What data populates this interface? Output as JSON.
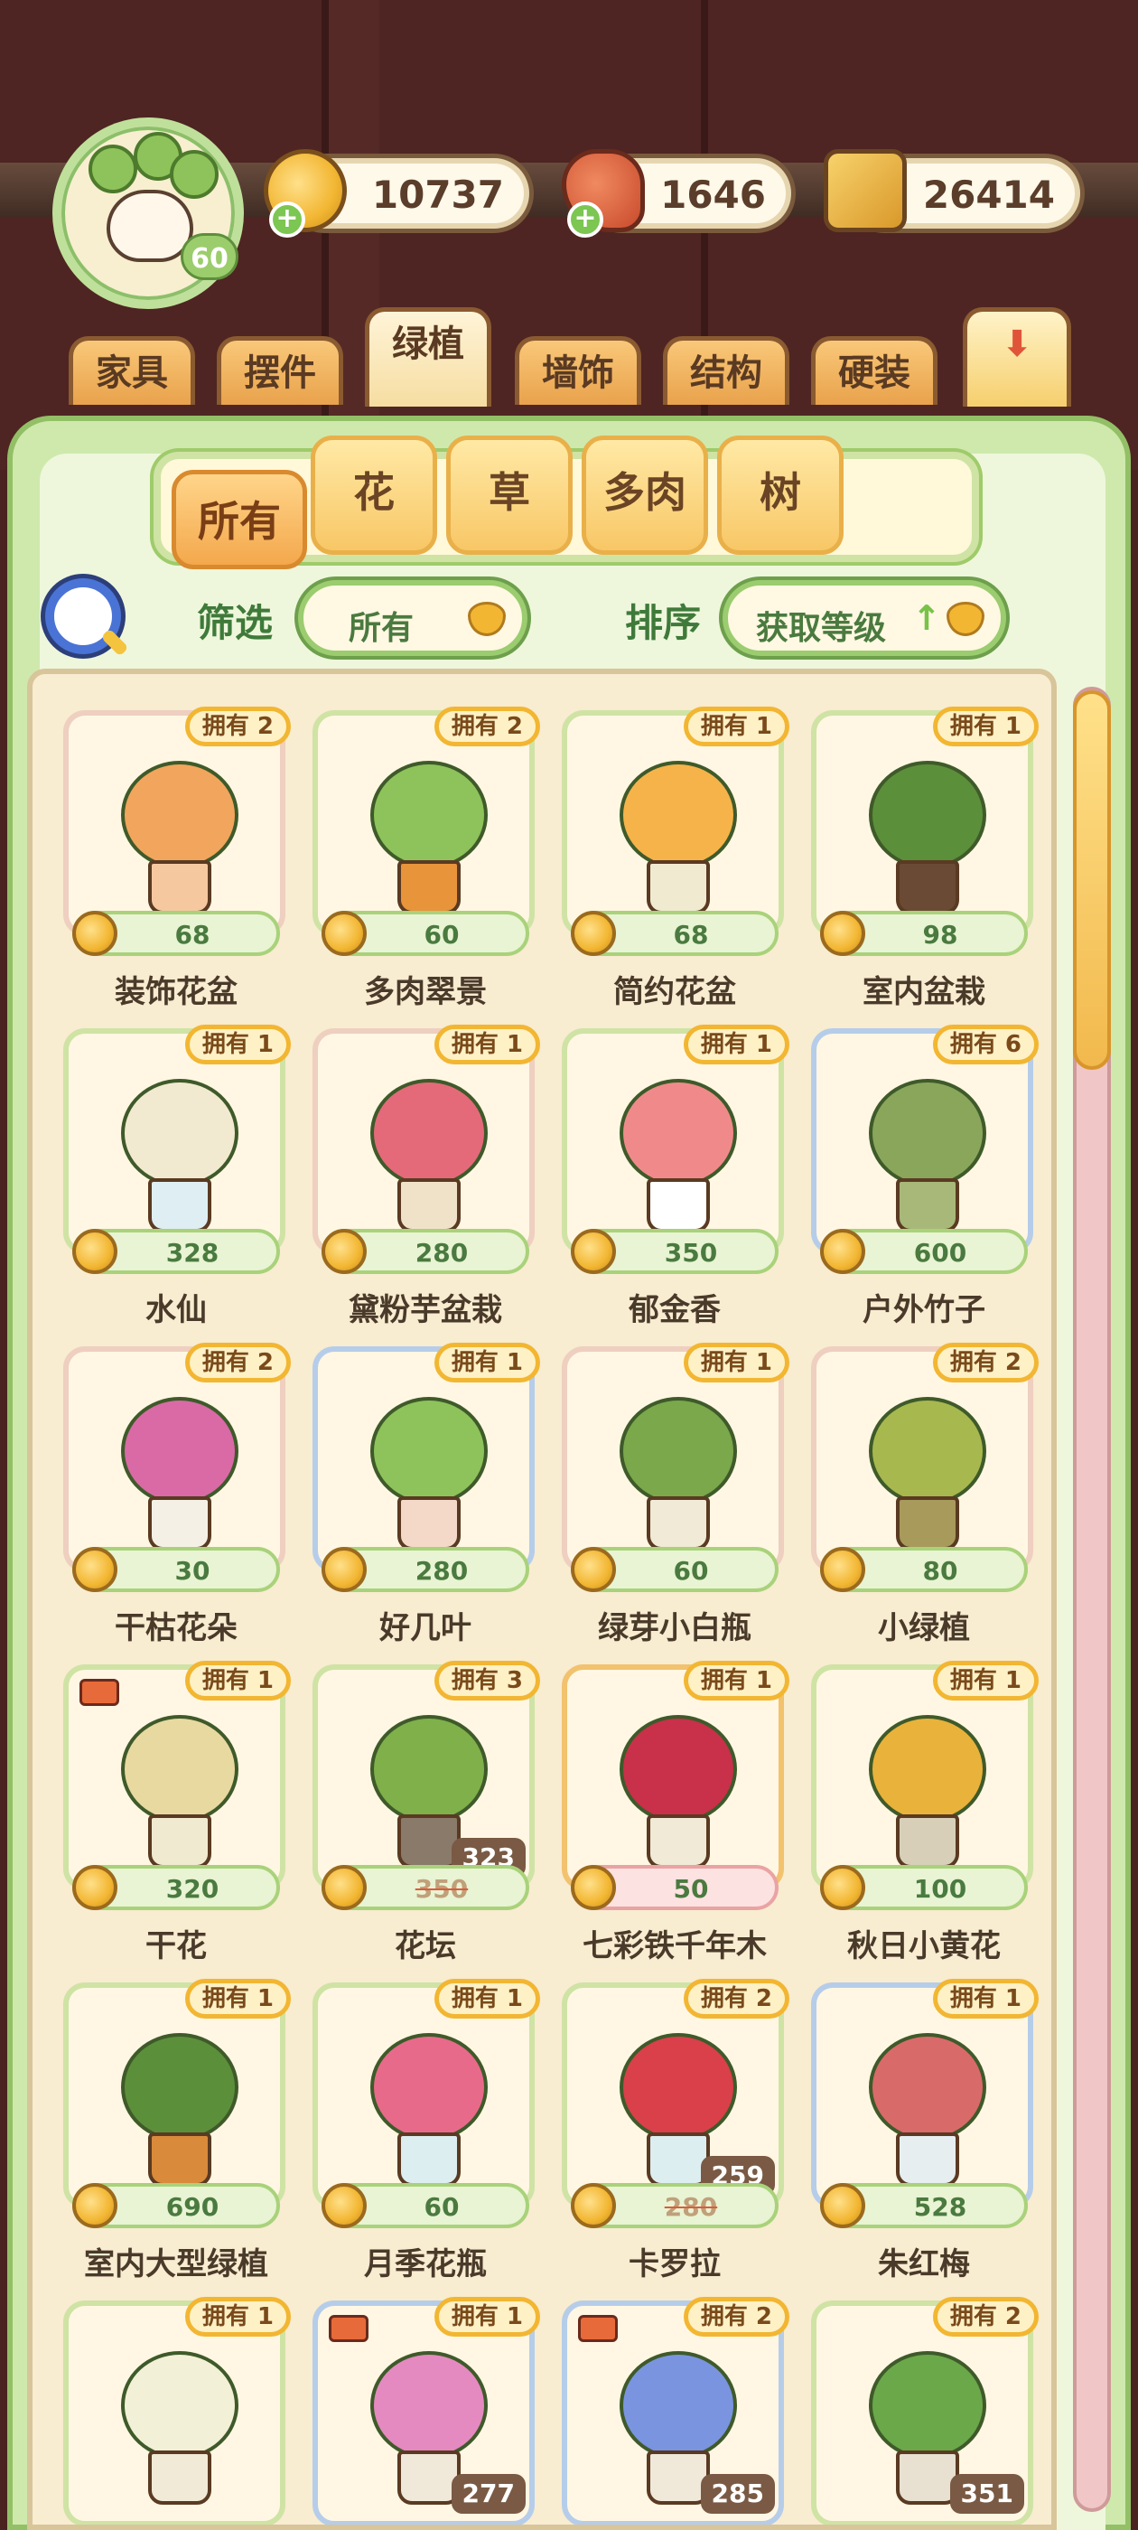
{
  "player": {
    "level": "60"
  },
  "resources": [
    {
      "name": "coin-icon",
      "value": "10737"
    },
    {
      "name": "meat-icon",
      "value": "1646"
    },
    {
      "name": "book-icon",
      "value": "26414"
    }
  ],
  "tabs": [
    {
      "label": "家具",
      "active": false
    },
    {
      "label": "摆件",
      "active": false
    },
    {
      "label": "绿植",
      "active": true
    },
    {
      "label": "墙饰",
      "active": false
    },
    {
      "label": "结构",
      "active": false
    },
    {
      "label": "硬装",
      "active": false
    }
  ],
  "subtabs": [
    {
      "label": "所有",
      "active": true
    },
    {
      "label": "花",
      "active": false
    },
    {
      "label": "草",
      "active": false
    },
    {
      "label": "多肉",
      "active": false
    },
    {
      "label": "树",
      "active": false
    }
  ],
  "filter": {
    "label": "筛选",
    "value": "所有"
  },
  "sort": {
    "label": "排序",
    "value": "获取等级"
  },
  "items": [
    {
      "name": "装饰花盆",
      "owned": "拥有 2",
      "price": "68",
      "border": "pink"
    },
    {
      "name": "多肉翠景",
      "owned": "拥有 2",
      "price": "60",
      "border": "green"
    },
    {
      "name": "简约花盆",
      "owned": "拥有 1",
      "price": "68",
      "border": "green"
    },
    {
      "name": "室内盆栽",
      "owned": "拥有 1",
      "price": "98",
      "border": "green"
    },
    {
      "name": "水仙",
      "owned": "拥有 1",
      "price": "328",
      "border": "green"
    },
    {
      "name": "黛粉芋盆栽",
      "owned": "拥有 1",
      "price": "280",
      "border": "pink"
    },
    {
      "name": "郁金香",
      "owned": "拥有 1",
      "price": "350",
      "border": "green"
    },
    {
      "name": "户外竹子",
      "owned": "拥有 6",
      "price": "600",
      "border": "blue"
    },
    {
      "name": "干枯花朵",
      "owned": "拥有 2",
      "price": "30",
      "border": "pink"
    },
    {
      "name": "好几叶",
      "owned": "拥有 1",
      "price": "280",
      "border": "blue"
    },
    {
      "name": "绿芽小白瓶",
      "owned": "拥有 1",
      "price": "60",
      "border": "pink"
    },
    {
      "name": "小绿植",
      "owned": "拥有 2",
      "price": "80",
      "border": "pink"
    },
    {
      "name": "干花",
      "owned": "拥有 1",
      "price": "320",
      "border": "green",
      "truck": true
    },
    {
      "name": "花坛",
      "owned": "拥有 3",
      "price": "350",
      "sale": "323",
      "border": "green"
    },
    {
      "name": "七彩铁千年木",
      "owned": "拥有 1",
      "price": "50",
      "border": "orange",
      "red": true
    },
    {
      "name": "秋日小黄花",
      "owned": "拥有 1",
      "price": "100",
      "border": "green"
    },
    {
      "name": "室内大型绿植",
      "owned": "拥有 1",
      "price": "690",
      "border": "green"
    },
    {
      "name": "月季花瓶",
      "owned": "拥有 1",
      "price": "60",
      "border": "green"
    },
    {
      "name": "卡罗拉",
      "owned": "拥有 2",
      "price": "280",
      "sale": "259",
      "border": "green"
    },
    {
      "name": "朱红梅",
      "owned": "拥有 1",
      "price": "528",
      "border": "blue"
    },
    {
      "name": "",
      "owned": "拥有 1",
      "price": "",
      "border": "green"
    },
    {
      "name": "",
      "owned": "拥有 1",
      "price": "",
      "sale": "277",
      "border": "blue",
      "truck": true
    },
    {
      "name": "",
      "owned": "拥有 2",
      "price": "",
      "sale": "285",
      "border": "blue",
      "truck": true
    },
    {
      "name": "",
      "owned": "拥有 2",
      "price": "",
      "sale": "351",
      "border": "green"
    }
  ],
  "colors": {
    "accent": "#f2b632",
    "panel": "#cfe9ad",
    "text": "#4a3a2a"
  }
}
